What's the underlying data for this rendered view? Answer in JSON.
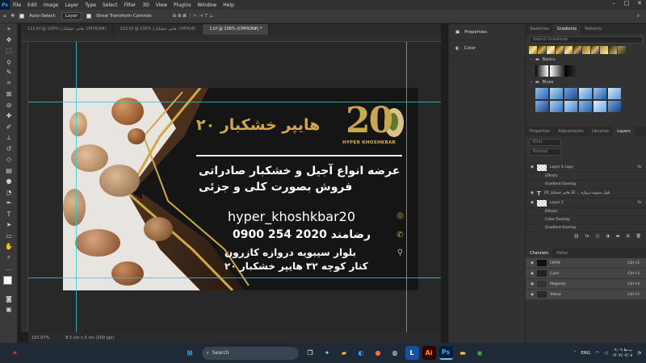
{
  "menu": {
    "app_icon": "Ps",
    "items": [
      "File",
      "Edit",
      "Image",
      "Layer",
      "Type",
      "Select",
      "Filter",
      "3D",
      "View",
      "Plugins",
      "Window",
      "Help"
    ]
  },
  "options": {
    "auto_select": "Auto-Select:",
    "layer_value": "Layer",
    "show_transform": "Show Transform Controls"
  },
  "tabs": [
    {
      "label": "111.tif @ 100% (هایپر خشکبار, CMYK/8#)"
    },
    {
      "label": "222.tif @ 100% (هایپر خشکبار, CMYK/8)"
    },
    {
      "label": "1.tif @ 106% (CMYK/8#) *"
    }
  ],
  "status": {
    "zoom": "105.97%",
    "size": "8.5 cm x 5 cm (300 ppi)"
  },
  "card": {
    "logo_number": "20",
    "logo_sub": "HYPER KHOSHKBAR",
    "brand": "هایپر خشکبار ۲۰",
    "tagline1": "عرضه انواع آجیل و خشکبار صادراتی",
    "tagline2": "فروش بصورت کلی و جزئی",
    "instagram": "hyper_khoshkbar20",
    "phone": "0900 254 2020  رضامند",
    "address1": "بلوار سیبویه دروازه کازرون",
    "address2": "کنار کوچه ۳۲ هایپر خشکبار ۲۰",
    "gold": "#d1a84a"
  },
  "mid_panel": {
    "items": [
      {
        "label": "Properties"
      },
      {
        "label": "Color"
      }
    ]
  },
  "right_panel": {
    "tabs_top": [
      "Swatches",
      "Gradients",
      "Patterns"
    ],
    "search_placeholder": "Search Gradients",
    "folders": [
      "Basics",
      "Blues"
    ],
    "tabs_mid": [
      "Properties",
      "Adjustments",
      "Libraries",
      "Layers"
    ],
    "kind": "Kind",
    "normal": "Normal",
    "layers": [
      {
        "name": "Layer 4 copy",
        "fx": "fx"
      },
      {
        "name": "Effects",
        "sub": true
      },
      {
        "name": "Gradient Overlay",
        "sub": true
      },
      {
        "name": "بلوار سیبویه دروازه ... 32 هایپر خشکبار 20",
        "type": true
      },
      {
        "name": "Layer 1",
        "fx": "fx"
      },
      {
        "name": "Effects",
        "sub": true
      },
      {
        "name": "Color Overlay",
        "sub": true
      },
      {
        "name": "Gradient Overlay",
        "sub": true
      }
    ],
    "tabs_bottom": [
      "Channels",
      "Paths"
    ],
    "channels": [
      {
        "name": "CMYK",
        "shortcut": "Ctrl+2"
      },
      {
        "name": "Cyan",
        "shortcut": "Ctrl+3"
      },
      {
        "name": "Magenta",
        "shortcut": "Ctrl+4"
      },
      {
        "name": "Yellow",
        "shortcut": "Ctrl+5"
      }
    ]
  },
  "taskbar": {
    "search": "Search",
    "lang": "ENG",
    "time": "۰۹:۰۹ ب.ظ",
    "date": "۱۴۰۲/۰۲/۰۸"
  }
}
